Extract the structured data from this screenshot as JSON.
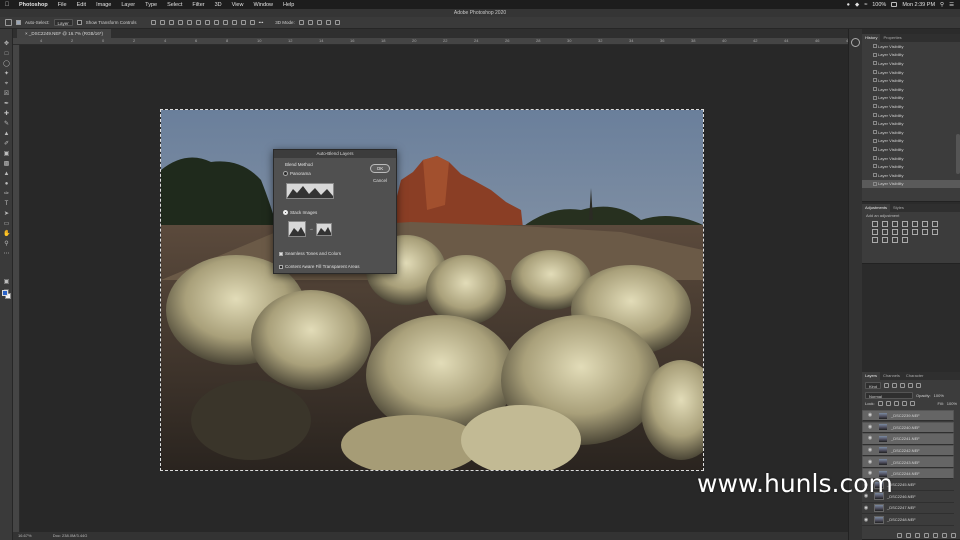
{
  "menubar": {
    "items": [
      "Photoshop",
      "File",
      "Edit",
      "Image",
      "Layer",
      "Type",
      "Select",
      "Filter",
      "3D",
      "View",
      "Window",
      "Help"
    ],
    "battery": "100%",
    "clock": "Mon 2:39 PM"
  },
  "window": {
    "title": "Adobe Photoshop 2020"
  },
  "options_bar": {
    "auto_select_label": "Auto-Select:",
    "auto_select_value": "Layer",
    "show_transform_label": "Show Transform Controls",
    "mode_label": "3D Mode:"
  },
  "document": {
    "tab_label": "_DSC2249.NEF @ 16.7% (RGB/16*)",
    "zoom": "16.67%",
    "doc_size": "Doc: 238.0M/3.44G"
  },
  "ruler": {
    "ticks": [
      "4",
      "2",
      "0",
      "2",
      "4",
      "6",
      "8",
      "10",
      "12",
      "14",
      "16",
      "18",
      "20",
      "22",
      "24",
      "26",
      "28",
      "30",
      "32",
      "34",
      "36",
      "38",
      "40",
      "42",
      "44",
      "46",
      "48"
    ]
  },
  "dialog": {
    "title": "Auto-Blend Layers",
    "blend_method_label": "Blend Method",
    "panorama_label": "Panorama",
    "stack_images_label": "Stack Images",
    "seamless_label": "Seamless Tones and Colors",
    "content_aware_label": "Content Aware Fill Transparent Areas",
    "ok_label": "OK",
    "cancel_label": "Cancel",
    "selected_method": "Stack Images",
    "seamless_checked": true,
    "content_aware_checked": false
  },
  "history": {
    "tabs": [
      "History",
      "Properties"
    ],
    "item_label": "Layer Visibility",
    "item_count": 17
  },
  "adjustments": {
    "tabs": [
      "Adjustments",
      "Styles"
    ],
    "subtitle": "Add an adjustment"
  },
  "layers": {
    "tabs": [
      "Layers",
      "Channels",
      "Character"
    ],
    "kind_label": "Kind",
    "blend_mode": "Normal",
    "opacity_label": "Opacity:",
    "opacity_value": "100%",
    "lock_label": "Lock:",
    "fill_label": "Fill:",
    "fill_value": "100%",
    "rows": [
      {
        "name": "_DSC2239.NEF",
        "selected": true
      },
      {
        "name": "_DSC2240.NEF",
        "selected": true
      },
      {
        "name": "_DSC2241.NEF",
        "selected": true
      },
      {
        "name": "_DSC2242.NEF",
        "selected": true
      },
      {
        "name": "_DSC2243.NEF",
        "selected": true
      },
      {
        "name": "_DSC2244.NEF",
        "selected": true
      },
      {
        "name": "_DSC2245.NEF",
        "selected": false
      },
      {
        "name": "_DSC2246.NEF",
        "selected": false
      },
      {
        "name": "_DSC2247.NEF",
        "selected": false
      },
      {
        "name": "_DSC2248.NEF",
        "selected": false
      }
    ]
  },
  "watermark": "www.hunls.com",
  "colors": {
    "foreground": "#2b63c8",
    "background": "#f2f2f2",
    "selected_row": "#656565"
  }
}
